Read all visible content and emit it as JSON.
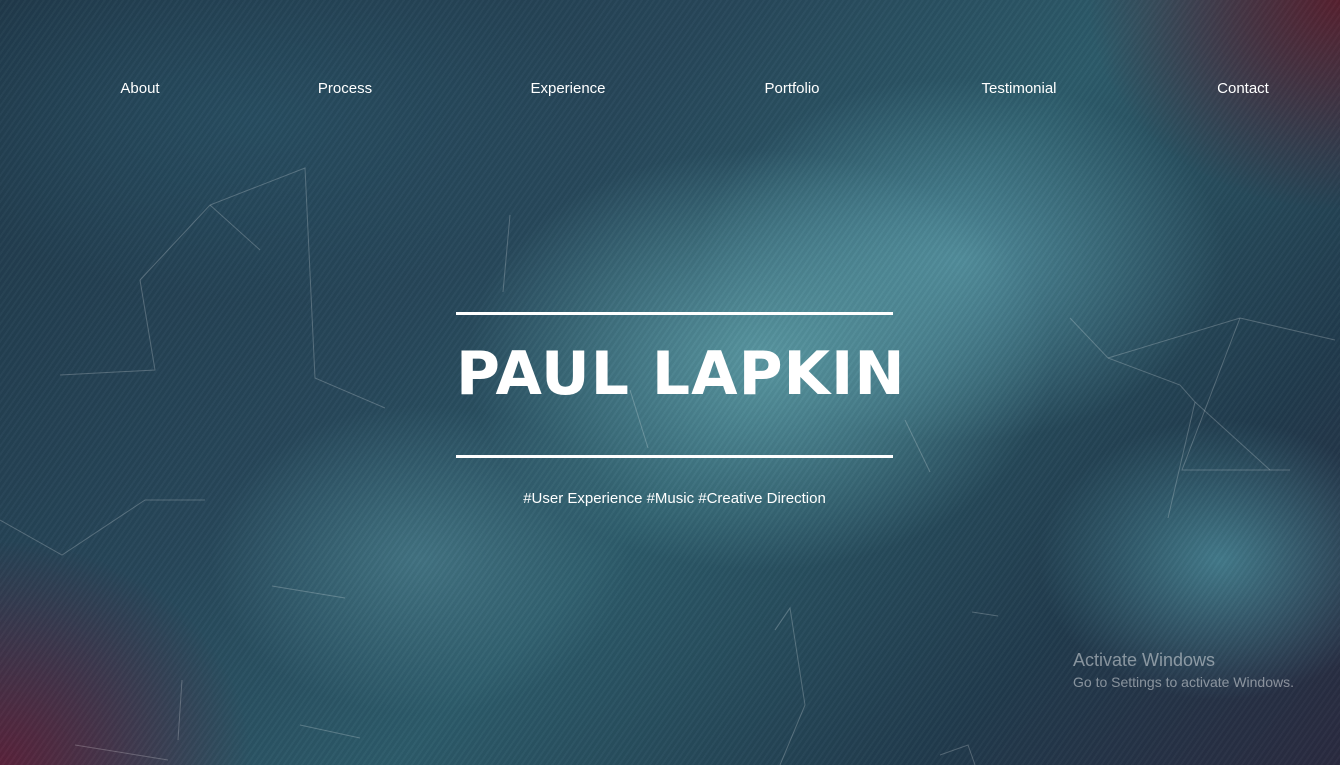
{
  "nav": {
    "items": [
      {
        "label": "About"
      },
      {
        "label": "Process"
      },
      {
        "label": "Experience"
      },
      {
        "label": "Portfolio"
      },
      {
        "label": "Testimonial"
      },
      {
        "label": "Contact"
      }
    ]
  },
  "hero": {
    "name": "PAUL LAPKIN",
    "tagline": "#User Experience #Music #Creative Direction"
  },
  "overlay": {
    "activate_title": "Activate Windows",
    "activate_subtitle": "Go to Settings to activate Windows."
  },
  "colors": {
    "text": "#ffffff",
    "background_teal": "#2c5b6a",
    "background_maroon": "#5a1e2d"
  }
}
